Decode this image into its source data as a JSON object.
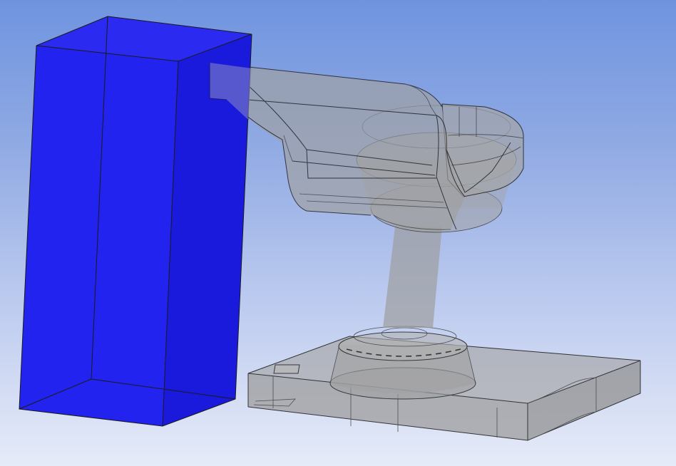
{
  "viewport": {
    "background_top": "#6f94df",
    "background_bottom": "#e6ebf8"
  },
  "model": {
    "selected_body_color": "#1e1ee8",
    "selected_body_face_front": "#2323f0",
    "selected_body_face_side": "#1a1adc",
    "transparent_body_color": "#9a9a9a",
    "edge_color": "#1b1b1b"
  }
}
